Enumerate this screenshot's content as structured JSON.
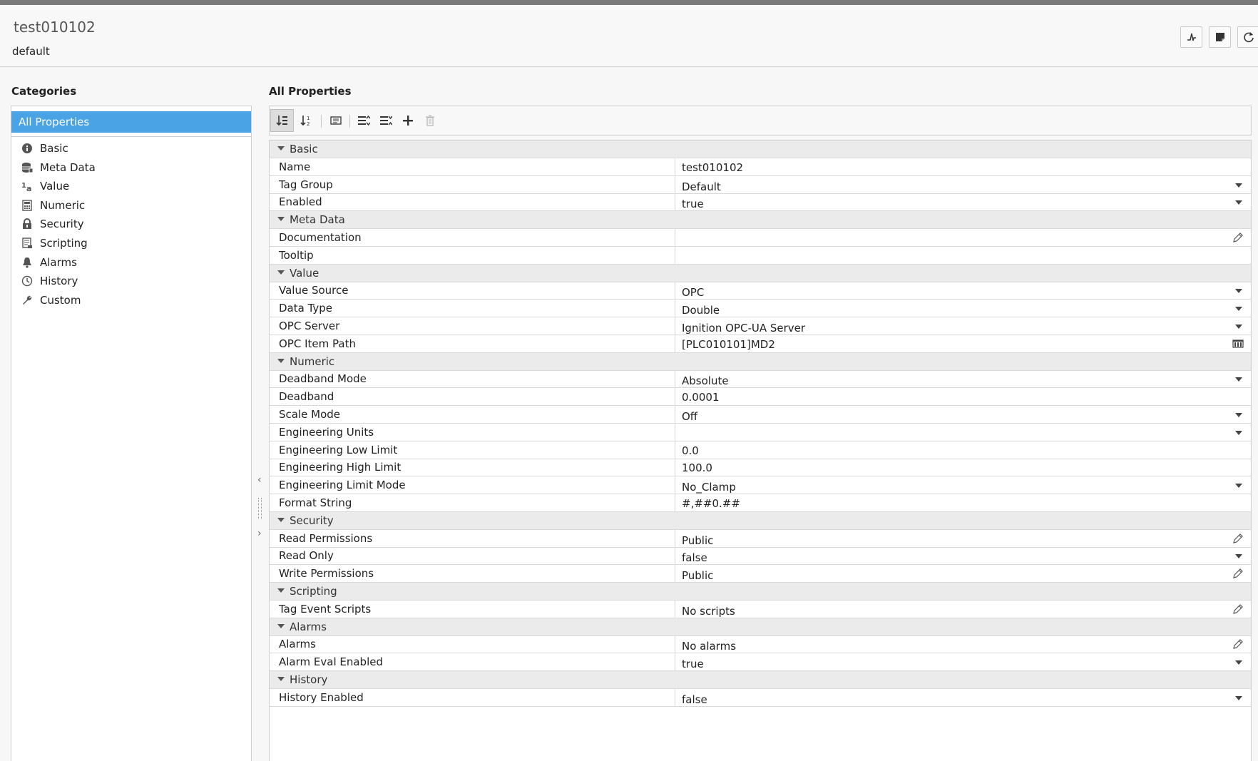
{
  "header": {
    "tag_name": "test010102",
    "provider": "default",
    "buttons": [
      "diagnostics-icon",
      "note-icon",
      "refresh-icon"
    ]
  },
  "categories": {
    "title": "Categories",
    "selected": "All Properties",
    "items": [
      {
        "label": "Basic",
        "icon": "info-icon"
      },
      {
        "label": "Meta Data",
        "icon": "database-icon"
      },
      {
        "label": "Value",
        "icon": "value-icon"
      },
      {
        "label": "Numeric",
        "icon": "calculator-icon"
      },
      {
        "label": "Security",
        "icon": "lock-icon"
      },
      {
        "label": "Scripting",
        "icon": "script-icon"
      },
      {
        "label": "Alarms",
        "icon": "bell-icon"
      },
      {
        "label": "History",
        "icon": "clock-icon"
      },
      {
        "label": "Custom",
        "icon": "wrench-icon"
      }
    ]
  },
  "properties": {
    "title": "All Properties",
    "toolbar": [
      "sort-category-icon",
      "sort-alpha-icon",
      "details-icon",
      "expand-all-icon",
      "collapse-all-icon",
      "add-icon",
      "delete-icon"
    ],
    "groups": [
      {
        "name": "Basic",
        "rows": [
          {
            "name": "Name",
            "value": "test010102",
            "editor": "text"
          },
          {
            "name": "Tag Group",
            "value": "Default",
            "editor": "dropdown"
          },
          {
            "name": "Enabled",
            "value": "true",
            "editor": "dropdown"
          }
        ]
      },
      {
        "name": "Meta Data",
        "rows": [
          {
            "name": "Documentation",
            "value": "",
            "editor": "edit"
          },
          {
            "name": "Tooltip",
            "value": "",
            "editor": "text"
          }
        ]
      },
      {
        "name": "Value",
        "rows": [
          {
            "name": "Value Source",
            "value": "OPC",
            "editor": "dropdown"
          },
          {
            "name": "Data Type",
            "value": "Double",
            "editor": "dropdown"
          },
          {
            "name": "OPC Server",
            "value": "Ignition OPC-UA Server",
            "editor": "dropdown"
          },
          {
            "name": "OPC Item Path",
            "value": "[PLC010101]MD2",
            "editor": "browse"
          }
        ]
      },
      {
        "name": "Numeric",
        "rows": [
          {
            "name": "Deadband Mode",
            "value": "Absolute",
            "editor": "dropdown"
          },
          {
            "name": "Deadband",
            "value": "0.0001",
            "editor": "text"
          },
          {
            "name": "Scale Mode",
            "value": "Off",
            "editor": "dropdown"
          },
          {
            "name": "Engineering Units",
            "value": "",
            "editor": "dropdown"
          },
          {
            "name": "Engineering Low Limit",
            "value": "0.0",
            "editor": "text"
          },
          {
            "name": "Engineering High Limit",
            "value": "100.0",
            "editor": "text"
          },
          {
            "name": "Engineering Limit Mode",
            "value": "No_Clamp",
            "editor": "dropdown"
          },
          {
            "name": "Format String",
            "value": "#,##0.##",
            "editor": "text"
          }
        ]
      },
      {
        "name": "Security",
        "rows": [
          {
            "name": "Read Permissions",
            "value": "Public",
            "editor": "edit"
          },
          {
            "name": "Read Only",
            "value": "false",
            "editor": "dropdown"
          },
          {
            "name": "Write Permissions",
            "value": "Public",
            "editor": "edit"
          }
        ]
      },
      {
        "name": "Scripting",
        "rows": [
          {
            "name": "Tag Event Scripts",
            "value": "No scripts",
            "editor": "edit"
          }
        ]
      },
      {
        "name": "Alarms",
        "rows": [
          {
            "name": "Alarms",
            "value": "No alarms",
            "editor": "edit"
          },
          {
            "name": "Alarm Eval Enabled",
            "value": "true",
            "editor": "dropdown"
          }
        ]
      },
      {
        "name": "History",
        "rows": [
          {
            "name": "History Enabled",
            "value": "false",
            "editor": "dropdown"
          }
        ]
      }
    ]
  },
  "colors": {
    "selection": "#4aa3e4",
    "group_bg": "#ebebeb",
    "grid_line": "#d9d9d9"
  }
}
